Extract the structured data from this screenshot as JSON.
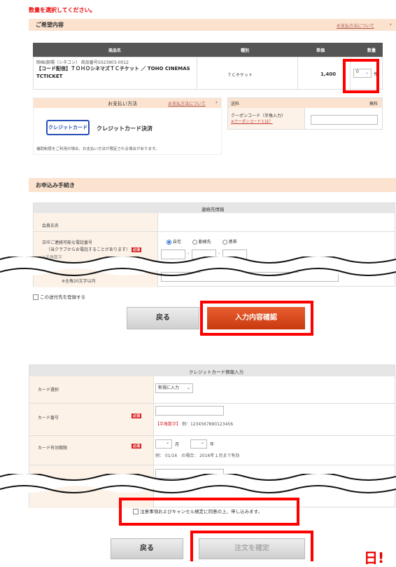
{
  "warning": "数量を選択してください。",
  "order": {
    "section_title": "ご希望内容",
    "payment_link": "お支払方法について",
    "headers": [
      "商品名",
      "種別",
      "単価",
      "数量"
    ],
    "item_line1": "映画/劇場（シネコン）",
    "item_code": "商品番号5023903-0012",
    "item_name": "【コード配信】ＴＯＨＯシネマズＴＣチケット ／ TOHO CINEMAS TCTICKET",
    "type": "ＴＣチケット",
    "price": "1,400",
    "qty": "0",
    "qty_unit": "件"
  },
  "payment": {
    "title": "お支払い方法",
    "link": "お支払方法について",
    "card_btn": "クレジットカード",
    "card_label": "クレジットカード決済",
    "note": "補助制度をご利用の場合、お支払い方法が限定される場合があります。",
    "shipping_label": "送料",
    "shipping_value": "無料",
    "coupon_label": "クーポンコード（半角入力）",
    "coupon_link": "※クーポンコードとは？"
  },
  "apply": {
    "section_title": "お申込み手続き",
    "contact_title": "連絡先情報",
    "member_label": "会員氏名",
    "phone_label": "日中ご連絡可能な電話番号",
    "phone_sub": "（当クラブからお電話することがあります）",
    "required": "必須",
    "halfwidth": "※半角数字",
    "radio_home": "自宅",
    "radio_work": "勤務先",
    "radio_mobile": "携帯",
    "name_note": "※全角20文字以内",
    "register_label": "この送付先を登録する",
    "back": "戻る",
    "confirm": "入力内容確認"
  },
  "card": {
    "title": "クレジットカード情報入力",
    "select_label": "カード選択",
    "select_value": "新規に入力",
    "number_label": "カード番号",
    "number_hint_tag": "【半角数字】",
    "number_hint": "例：1234567890123456",
    "expiry_label": "カード有効期限",
    "month_unit": "月",
    "year_unit": "年",
    "expiry_hint": "例： 01/16　の場合： 2016年１月まで有効",
    "required": "必須"
  },
  "agree": {
    "label": "注意事項およびキャンセル規定に同意の上、申し込みます。",
    "back": "戻る",
    "submit": "注文を確定"
  },
  "corner_text": "日!"
}
